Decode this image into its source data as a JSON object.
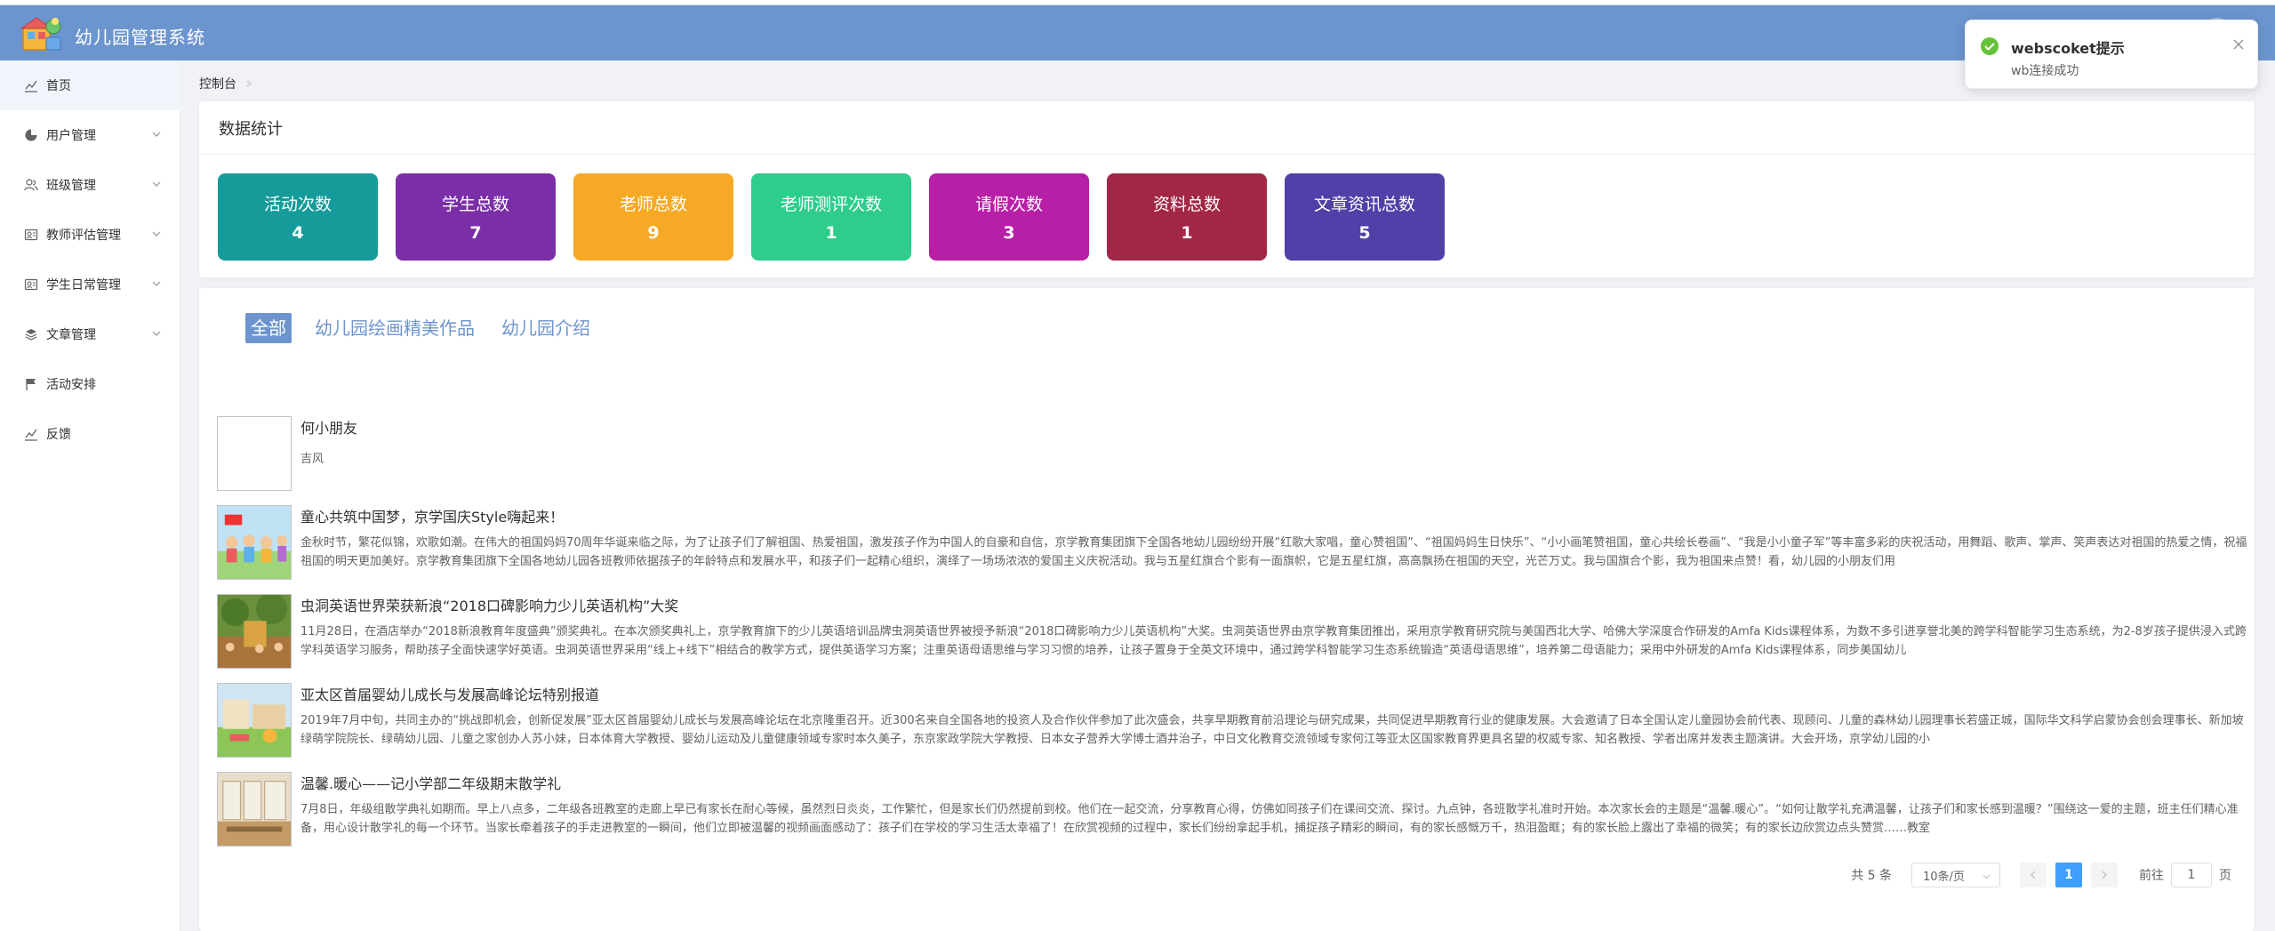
{
  "app": {
    "title": "幼儿园管理系统"
  },
  "sidebar": {
    "items": [
      {
        "label": "首页",
        "icon": "chart-line-icon",
        "has_arrow": false,
        "active": true
      },
      {
        "label": "用户管理",
        "icon": "pie-chart-icon",
        "has_arrow": true
      },
      {
        "label": "班级管理",
        "icon": "users-icon",
        "has_arrow": true
      },
      {
        "label": "教师评估管理",
        "icon": "badge-icon",
        "has_arrow": true
      },
      {
        "label": "学生日常管理",
        "icon": "badge-icon",
        "has_arrow": true
      },
      {
        "label": "文章管理",
        "icon": "layers-icon",
        "has_arrow": true
      },
      {
        "label": "活动安排",
        "icon": "flag-icon",
        "has_arrow": false
      },
      {
        "label": "反馈",
        "icon": "chart-line-icon",
        "has_arrow": false
      }
    ]
  },
  "breadcrumb": {
    "current": "控制台"
  },
  "stats": {
    "title": "数据统计",
    "cards": [
      {
        "label": "活动次数",
        "value": "4",
        "color": "#169b9b"
      },
      {
        "label": "学生总数",
        "value": "7",
        "color": "#7a2ea8"
      },
      {
        "label": "老师总数",
        "value": "9",
        "color": "#f7a926"
      },
      {
        "label": "老师测评次数",
        "value": "1",
        "color": "#2ecc8d"
      },
      {
        "label": "请假次数",
        "value": "3",
        "color": "#b81fa7"
      },
      {
        "label": "资料总数",
        "value": "1",
        "color": "#a22746"
      },
      {
        "label": "文章资讯总数",
        "value": "5",
        "color": "#5040a8"
      }
    ]
  },
  "articles": {
    "tabs": [
      "全部",
      "幼儿园绘画精美作品",
      "幼儿园介绍"
    ],
    "active_tab": 0,
    "items": [
      {
        "title": "何小朋友",
        "summary": "吉风",
        "thumb": "empty"
      },
      {
        "title": "童心共筑中国梦，京学国庆Style嗨起来！",
        "summary": "金秋时节，繁花似锦，欢歌如潮。在伟大的祖国妈妈70周年华诞来临之际，为了让孩子们了解祖国、热爱祖国，激发孩子作为中国人的自豪和自信，京学教育集团旗下全国各地幼儿园纷纷开展“红歌大家唱，童心赞祖国”、“祖国妈妈生日快乐”、“小小画笔赞祖国，童心共绘长卷画”、“我是小小童子军”等丰富多彩的庆祝活动，用舞蹈、歌声、掌声、笑声表达对祖国的热爱之情，祝福祖国的明天更加美好。京学教育集团旗下全国各地幼儿园各班教师依据孩子的年龄特点和发展水平，和孩子们一起精心组织，演绎了一场场浓浓的爱国主义庆祝活动。我与五星红旗合个影有一面旗帜，它是五星红旗，高高飘扬在祖国的天空，光芒万丈。我与国旗合个影，我为祖国来点赞！看，幼儿园的小朋友们用",
        "thumb": "kids"
      },
      {
        "title": "虫洞英语世界荣获新浪“2018口碑影响力少儿英语机构”大奖",
        "summary": "11月28日，在酒店举办“2018新浪教育年度盛典”颁奖典礼。在本次颁奖典礼上，京学教育旗下的少儿英语培训品牌虫洞英语世界被授予新浪“2018口碑影响力少儿英语机构”大奖。虫洞英语世界由京学教育集团推出，采用京学教育研究院与美国西北大学、哈佛大学深度合作研发的Amfa Kids课程体系，为数不多引进享誉北美的跨学科智能学习生态系统，为2-8岁孩子提供浸入式跨学科英语学习服务，帮助孩子全面快速学好英语。虫洞英语世界采用“线上+线下”相结合的教学方式，提供英语学习方案；注重英语母语思维与学习习惯的培养，让孩子置身于全英文环境中，通过跨学科智能学习生态系统锻造“英语母语思维”，培养第二母语能力；采用中外研发的Amfa Kids课程体系，同步美国幼儿",
        "thumb": "garden"
      },
      {
        "title": "亚太区首届婴幼儿成长与发展高峰论坛特别报道",
        "summary": "2019年7月中旬，共同主办的“挑战即机会，创新促发展”亚太区首届婴幼儿成长与发展高峰论坛在北京隆重召开。近300名来自全国各地的投资人及合作伙伴参加了此次盛会，共享早期教育前沿理论与研究成果，共同促进早期教育行业的健康发展。大会邀请了日本全国认定儿童园协会前代表、现顾问、儿童的森林幼儿园理事长若盛正城，国际华文科学启蒙协会创会理事长、新加坡绿萌学院院长、绿萌幼儿园、儿童之家创办人苏小妹，日本体育大学教授、婴幼儿运动及儿童健康领域专家时本久美子，东京家政学院大学教授、日本女子营养大学博士酒井治子，中日文化教育交流领域专家何江等亚太区国家教育界更具名望的权威专家、知名教授、学者出席并发表主题演讲。大会开场，京学幼儿园的小",
        "thumb": "playground"
      },
      {
        "title": "温馨.暖心——记小学部二年级期末散学礼",
        "summary": "7月8日，年级组散学典礼如期而。早上八点多，二年级各班教室的走廊上早已有家长在耐心等候，虽然烈日炎炎，工作繁忙，但是家长们仍然提前到校。他们在一起交流，分享教育心得，仿佛如同孩子们在课间交流、探讨。九点钟，各班散学礼准时开始。本次家长会的主题是“温馨.暖心”。“如何让散学礼充满温馨，让孩子们和家长感到温暖？”围绕这一爱的主题，班主任们精心准备，用心设计散学礼的每一个环节。当家长牵着孩子的手走进教室的一瞬间，他们立即被温馨的视频画面感动了：孩子们在学校的学习生活太幸福了！在欣赏视频的过程中，家长们纷纷拿起手机，捕捉孩子精彩的瞬间，有的家长感慨万千，热泪盈眶；有的家长脸上露出了幸福的微笑；有的家长边欣赏边点头赞赏……教室",
        "thumb": "classroom"
      }
    ]
  },
  "pagination": {
    "total_text": "共 5 条",
    "page_size": "10条/页",
    "current_page": "1",
    "goto_label": "前往",
    "goto_value": "1",
    "page_unit": "页"
  },
  "notification": {
    "title": "webscoket提示",
    "message": "wb连接成功",
    "icon": "check-circle-icon"
  },
  "colors": {
    "header": "#6c95cf",
    "accent": "#409eff",
    "success": "#67c23a"
  }
}
